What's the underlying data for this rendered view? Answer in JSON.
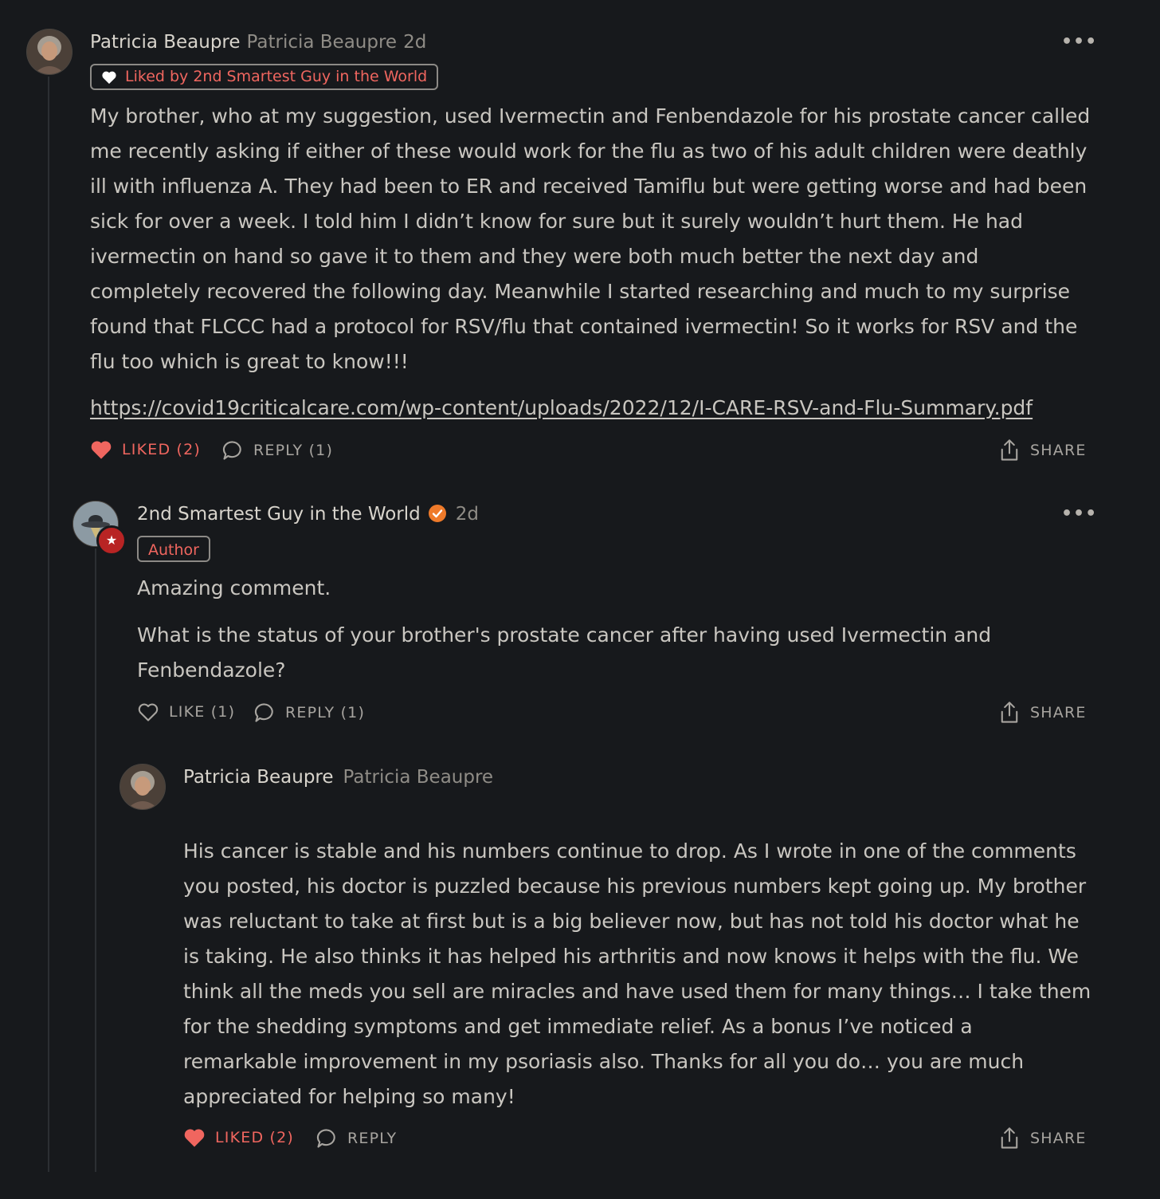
{
  "comment1": {
    "author_name": "Patricia Beaupre",
    "author_handle": "Patricia Beaupre",
    "time": "2d",
    "liked_by_tag": "Liked by 2nd Smartest Guy in the World",
    "body": "My brother, who at my suggestion, used Ivermectin and Fenbendazole for his prostate cancer called me recently asking if either of these would work for the flu as two of his adult children were deathly ill with influenza A. They had been to ER and received Tamiflu but were getting worse and had been sick for over a week. I told him I didn’t know for sure but it surely wouldn’t hurt them. He had ivermectin on hand so gave it to them and they were both much better the next day and completely recovered the following day. Meanwhile I started researching and much to my surprise found that FLCCC had a protocol for RSV/flu that contained ivermectin! So it works for RSV and the flu too which is great to know!!!",
    "link": "https://covid19criticalcare.com/wp-content/uploads/2022/12/I-CARE-RSV-and-Flu-Summary.pdf",
    "like_label": "LIKED (2)",
    "reply_label": "REPLY (1)",
    "share_label": "SHARE"
  },
  "comment2": {
    "author_name": "2nd Smartest Guy in the World",
    "time": "2d",
    "author_tag": "Author",
    "paragraph1": "Amazing comment.",
    "paragraph2": "What is the status of your brother's prostate cancer after having used Ivermectin and Fenbendazole?",
    "like_label": "LIKE (1)",
    "reply_label": "REPLY (1)",
    "share_label": "SHARE"
  },
  "comment3": {
    "author_name": "Patricia Beaupre",
    "author_handle": "Patricia Beaupre",
    "body": "His cancer is stable and his numbers continue to drop. As I wrote in one of the comments you posted, his doctor is puzzled because his previous numbers kept going up. My brother was reluctant to take at first but is a big believer now, but has not told his doctor what he is taking. He also thinks it has helped his arthritis and now knows it helps with the flu. We think all the meds you sell are miracles and have used them for many things… I take them for the shedding symptoms and get immediate relief. As a bonus I’ve noticed a remarkable improvement in my psoriasis also. Thanks for all you do… you are much appreciated for helping so many!",
    "like_label": "LIKED (2)",
    "reply_label": "REPLY",
    "share_label": "SHARE"
  },
  "more_label": "•••",
  "icons": {
    "heart_filled": "heart-filled-icon",
    "heart_outline": "heart-outline-icon",
    "reply": "speech-bubble-icon",
    "share": "share-icon",
    "more": "more-horizontal-icon"
  },
  "colors": {
    "background": "#17191c",
    "accent_red": "#f0665f",
    "verified_orange": "#ef7a2a",
    "text": "#c9c6c0",
    "muted": "#8f8c86"
  }
}
